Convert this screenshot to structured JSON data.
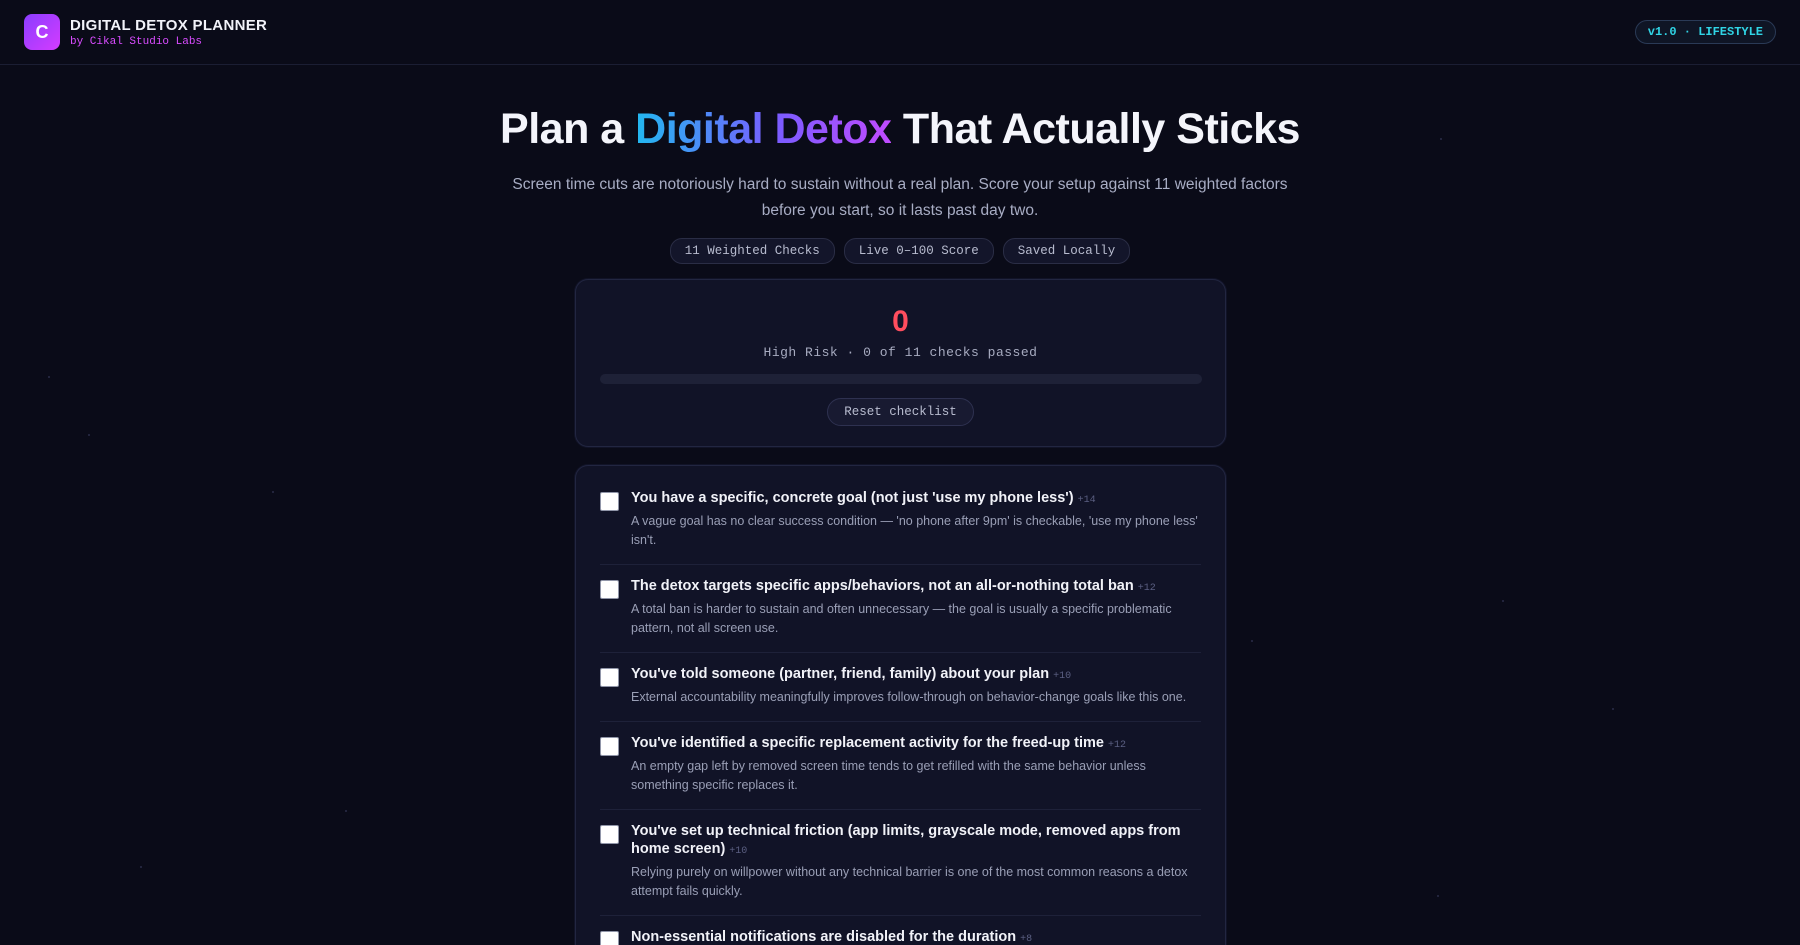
{
  "header": {
    "logo_letter": "C",
    "title": "DIGITAL DETOX PLANNER",
    "subtitle": "by Cikal Studio Labs",
    "version": "v1.0 · LIFESTYLE"
  },
  "hero": {
    "title_before": "Plan a",
    "title_highlight": "Digital Detox",
    "title_after": "That Actually Sticks",
    "description": "Screen time cuts are notoriously hard to sustain without a real plan. Score your setup against 11 weighted factors before you start, so it lasts past day two.",
    "chips": [
      "11 Weighted Checks",
      "Live 0–100 Score",
      "Saved Locally"
    ]
  },
  "score": {
    "value": "0",
    "label": "High Risk · 0 of 11 checks passed",
    "progress_fraction": 0,
    "reset_label": "Reset checklist",
    "risk_color": "#ff4d5e"
  },
  "checklist": {
    "items": [
      {
        "title": "You have a specific, concrete goal (not just 'use my phone less')",
        "weight": "+14",
        "description": "A vague goal has no clear success condition — 'no phone after 9pm' is checkable, 'use my phone less' isn't."
      },
      {
        "title": "The detox targets specific apps/behaviors, not an all-or-nothing total ban",
        "weight": "+12",
        "description": "A total ban is harder to sustain and often unnecessary — the goal is usually a specific problematic pattern, not all screen use."
      },
      {
        "title": "You've told someone (partner, friend, family) about your plan",
        "weight": "+10",
        "description": "External accountability meaningfully improves follow-through on behavior-change goals like this one."
      },
      {
        "title": "You've identified a specific replacement activity for the freed-up time",
        "weight": "+12",
        "description": "An empty gap left by removed screen time tends to get refilled with the same behavior unless something specific replaces it."
      },
      {
        "title": "You've set up technical friction (app limits, grayscale mode, removed apps from home screen)",
        "weight": "+10",
        "description": "Relying purely on willpower without any technical barrier is one of the most common reasons a detox attempt fails quickly."
      },
      {
        "title": "Non-essential notifications are disabled for the duration",
        "weight": "+8",
        "description": ""
      }
    ]
  }
}
